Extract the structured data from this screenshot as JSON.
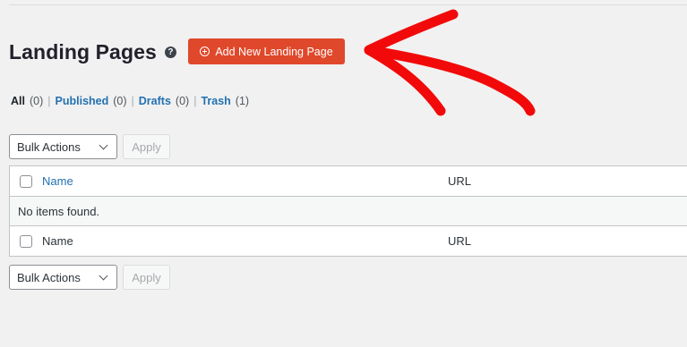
{
  "header": {
    "title": "Landing Pages",
    "help_icon": "question-circle-icon",
    "add_button_label": "Add New Landing Page",
    "add_button_icon": "plus-circle-icon",
    "accent_color": "#e0482b"
  },
  "filters": [
    {
      "label": "All",
      "count": "(0)",
      "current": true
    },
    {
      "label": "Published",
      "count": "(0)",
      "current": false
    },
    {
      "label": "Drafts",
      "count": "(0)",
      "current": false
    },
    {
      "label": "Trash",
      "count": "(1)",
      "current": false
    }
  ],
  "bulk_actions": {
    "top": {
      "select_value": "Bulk Actions",
      "apply_label": "Apply"
    },
    "bottom": {
      "select_value": "Bulk Actions",
      "apply_label": "Apply"
    }
  },
  "table": {
    "columns": [
      "Name",
      "URL"
    ],
    "empty_message": "No items found.",
    "footer_columns": [
      "Name",
      "URL"
    ]
  },
  "annotation": {
    "arrow_color": "#f20a0a"
  }
}
